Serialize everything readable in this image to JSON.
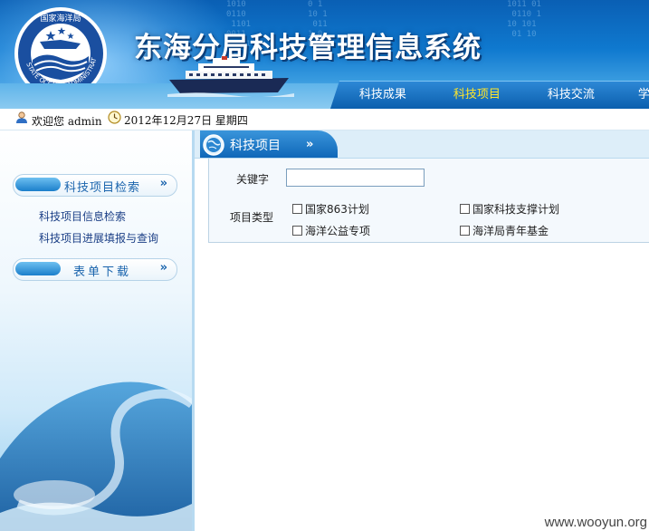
{
  "header": {
    "system_title": "东海分局科技管理信息系统",
    "logo_text_top": "国家海洋局",
    "logo_text_ring": "STATE OCEANIC ADMINISTRATION",
    "nav_tabs": [
      {
        "label": "科技成果",
        "active": false
      },
      {
        "label": "科技项目",
        "active": true
      },
      {
        "label": "科技交流",
        "active": false
      },
      {
        "label": "学",
        "active": false
      }
    ]
  },
  "infobar": {
    "welcome": "欢迎您 admin",
    "date": "2012年12月27日  星期四"
  },
  "sidebar": {
    "sections": [
      {
        "label": "科技项目检索",
        "chevron": "»"
      },
      {
        "label": "表单下载",
        "chevron": "»"
      }
    ],
    "links": [
      "科技项目信息检索",
      "科技项目进展填报与查询"
    ]
  },
  "main": {
    "tab_title": "科技项目",
    "tab_chevron": "»",
    "keyword_label": "关键字",
    "keyword_value": "",
    "type_label": "项目类型",
    "checkboxes": [
      {
        "label": "国家863计划",
        "checked": false
      },
      {
        "label": "国家科技支撑计划",
        "checked": false
      },
      {
        "label": "海洋公益专项",
        "checked": false
      },
      {
        "label": "海洋局青年基金",
        "checked": false
      }
    ]
  },
  "watermark": "www.wooyun.org",
  "colors": {
    "header_blue": "#0f79cf",
    "active_nav_text": "#ffe62a",
    "sidebar_link": "#1b3f86",
    "tab_blue": "#0f67b8"
  }
}
